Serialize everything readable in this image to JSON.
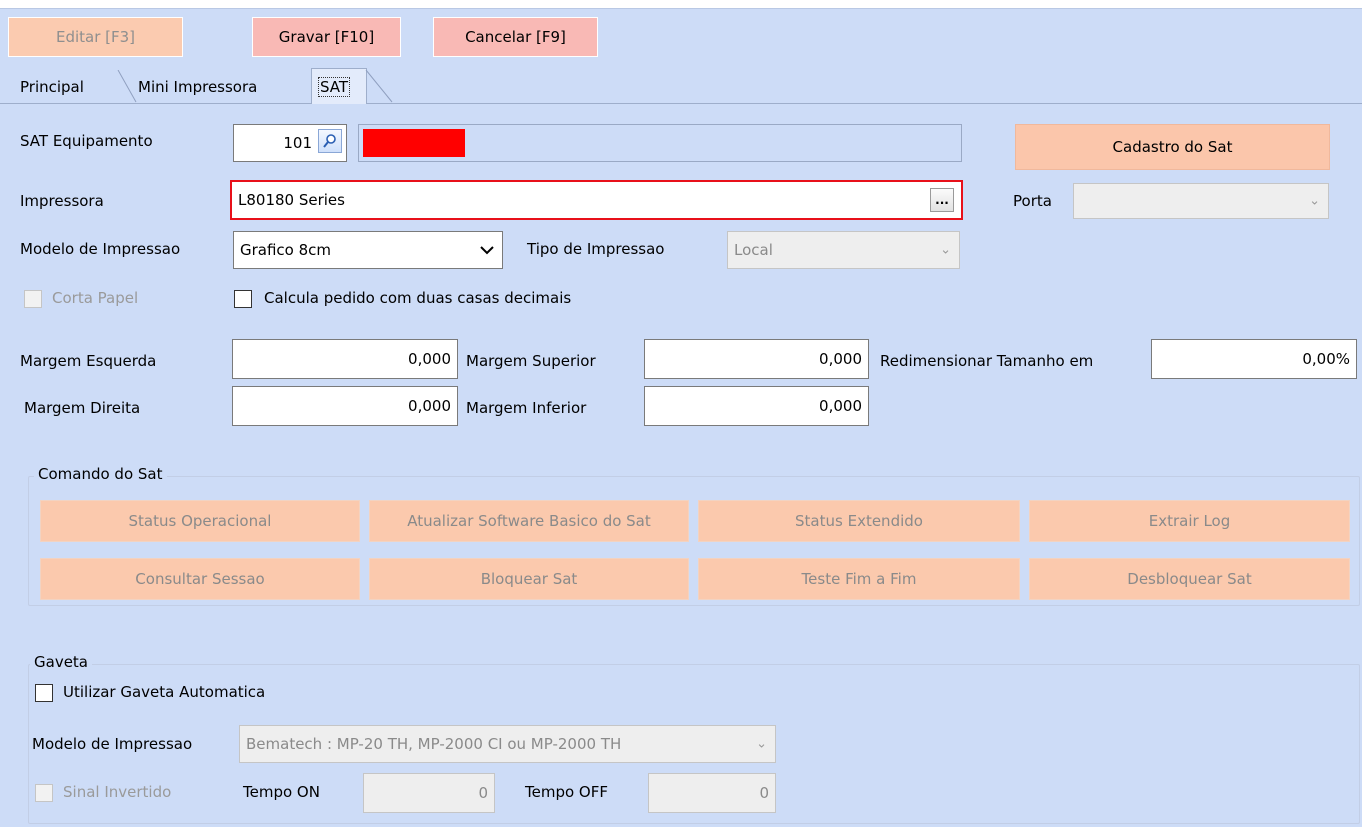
{
  "toolbar": {
    "edit_label": "Editar [F3]",
    "save_label": "Gravar [F10]",
    "cancel_label": "Cancelar [F9]"
  },
  "tabs": [
    {
      "label": "Principal"
    },
    {
      "label": "Mini Impressora"
    },
    {
      "label": "SAT"
    }
  ],
  "form": {
    "sat_equipamento_label": "SAT Equipamento",
    "sat_equipamento_value": "101",
    "cadastro_button": "Cadastro do Sat",
    "impressora_label": "Impressora",
    "impressora_value": "L80180 Series",
    "ellipsis": "...",
    "porta_label": "Porta",
    "porta_value": "",
    "modelo_label": "Modelo de Impressao",
    "modelo_value": "Grafico 8cm",
    "tipo_label": "Tipo de Impressao",
    "tipo_value": "Local",
    "corta_papel_label": "Corta Papel",
    "calcula_label": "Calcula pedido com duas casas decimais",
    "margem_esquerda_label": "Margem Esquerda",
    "margem_esquerda_value": "0,000",
    "margem_superior_label": "Margem Superior",
    "margem_superior_value": "0,000",
    "redimensionar_label": "Redimensionar Tamanho em",
    "redimensionar_value": "0,00%",
    "margem_direita_label": "Margem Direita",
    "margem_direita_value": "0,000",
    "margem_inferior_label": "Margem Inferior",
    "margem_inferior_value": "0,000"
  },
  "comando": {
    "title": "Comando do Sat",
    "buttons": [
      "Status Operacional",
      "Atualizar Software Basico do Sat",
      "Status Extendido",
      "Extrair Log",
      "Consultar Sessao",
      "Bloquear Sat",
      "Teste Fim a Fim",
      "Desbloquear Sat"
    ]
  },
  "gaveta": {
    "title": "Gaveta",
    "utilizar_label": "Utilizar Gaveta Automatica",
    "modelo_label": "Modelo de Impressao",
    "modelo_value": "Bematech : MP-20 TH, MP-2000 CI ou MP-2000 TH",
    "sinal_label": "Sinal Invertido",
    "tempo_on_label": "Tempo ON",
    "tempo_on_value": "0",
    "tempo_off_label": "Tempo OFF",
    "tempo_off_value": "0"
  },
  "colors": {
    "background": "#cddcf7",
    "button_orange": "#fbc6ab",
    "button_red": "#f9b9b5",
    "highlight_red": "#e8101a",
    "status_red": "#ff0000"
  },
  "icons": {
    "search": "search-icon",
    "ellipsis": "ellipsis-icon",
    "dropdown": "chevron-down-icon"
  }
}
